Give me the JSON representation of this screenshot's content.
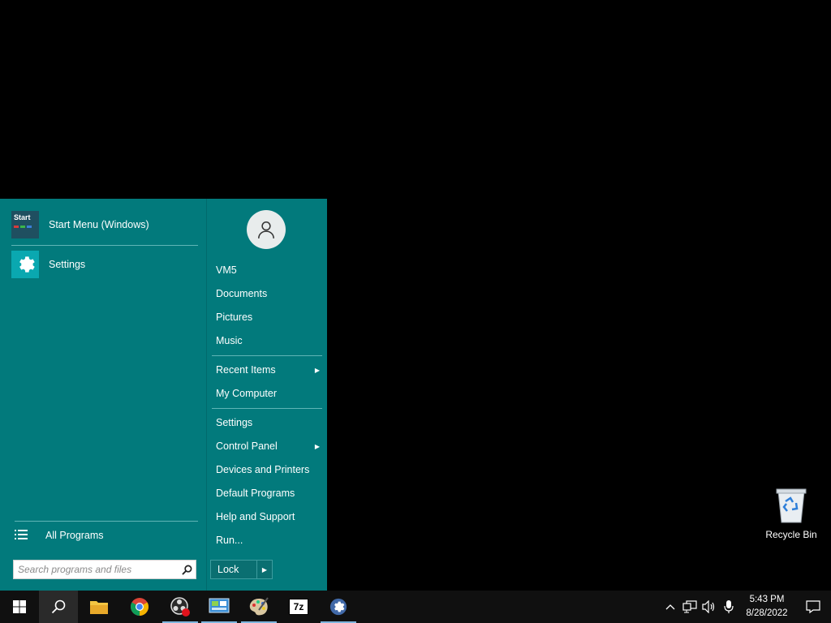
{
  "colors": {
    "menu_bg": "#027a7c",
    "taskbar_bg": "#101010",
    "desktop_bg": "#000000",
    "accent_underline": "#7fb6de"
  },
  "left_pane": {
    "pinned": [
      {
        "label": "Start Menu (Windows)",
        "icon": "start-menu-app-icon",
        "icon_text": "Start"
      },
      {
        "label": "Settings",
        "icon": "gear-icon"
      }
    ],
    "all_programs": {
      "label": "All Programs",
      "icon": "list-icon"
    },
    "search": {
      "placeholder": "Search programs and files",
      "icon": "search-icon"
    }
  },
  "right_pane": {
    "user_icon": "user-avatar-icon",
    "items": [
      {
        "label": "VM5"
      },
      {
        "label": "Documents"
      },
      {
        "label": "Pictures"
      },
      {
        "label": "Music"
      },
      {
        "label": "Recent Items",
        "submenu": true
      },
      {
        "label": "My Computer"
      },
      {
        "label": "Settings"
      },
      {
        "label": "Control Panel",
        "submenu": true
      },
      {
        "label": "Devices and Printers"
      },
      {
        "label": "Default Programs"
      },
      {
        "label": "Help and Support"
      },
      {
        "label": "Run..."
      }
    ],
    "lock": {
      "label": "Lock",
      "arrow_icon": "chevron-right-icon"
    }
  },
  "desktop": {
    "recycle_bin": {
      "label": "Recycle Bin",
      "icon": "recycle-bin-icon"
    }
  },
  "taskbar": {
    "buttons": [
      {
        "name": "start-button",
        "icon": "windows-logo-icon"
      },
      {
        "name": "search-taskbar-button",
        "icon": "search-icon",
        "active": true
      },
      {
        "name": "file-explorer-button",
        "icon": "folder-icon"
      },
      {
        "name": "chrome-button",
        "icon": "chrome-icon"
      },
      {
        "name": "obs-button",
        "icon": "obs-record-icon",
        "running": true
      },
      {
        "name": "control-panel-button",
        "icon": "control-panel-icon",
        "running": true
      },
      {
        "name": "paint-button",
        "icon": "paint-palette-icon",
        "running": true
      },
      {
        "name": "7zip-button",
        "icon": "7zip-icon",
        "icon_text": "7z"
      },
      {
        "name": "settings-taskbar-button",
        "icon": "gear-icon",
        "running": true
      }
    ],
    "tray": {
      "icons": [
        "chevron-up-icon",
        "network-icon",
        "volume-icon",
        "microphone-icon"
      ],
      "time": "5:43 PM",
      "date": "8/28/2022",
      "notification_icon": "notification-icon"
    }
  }
}
